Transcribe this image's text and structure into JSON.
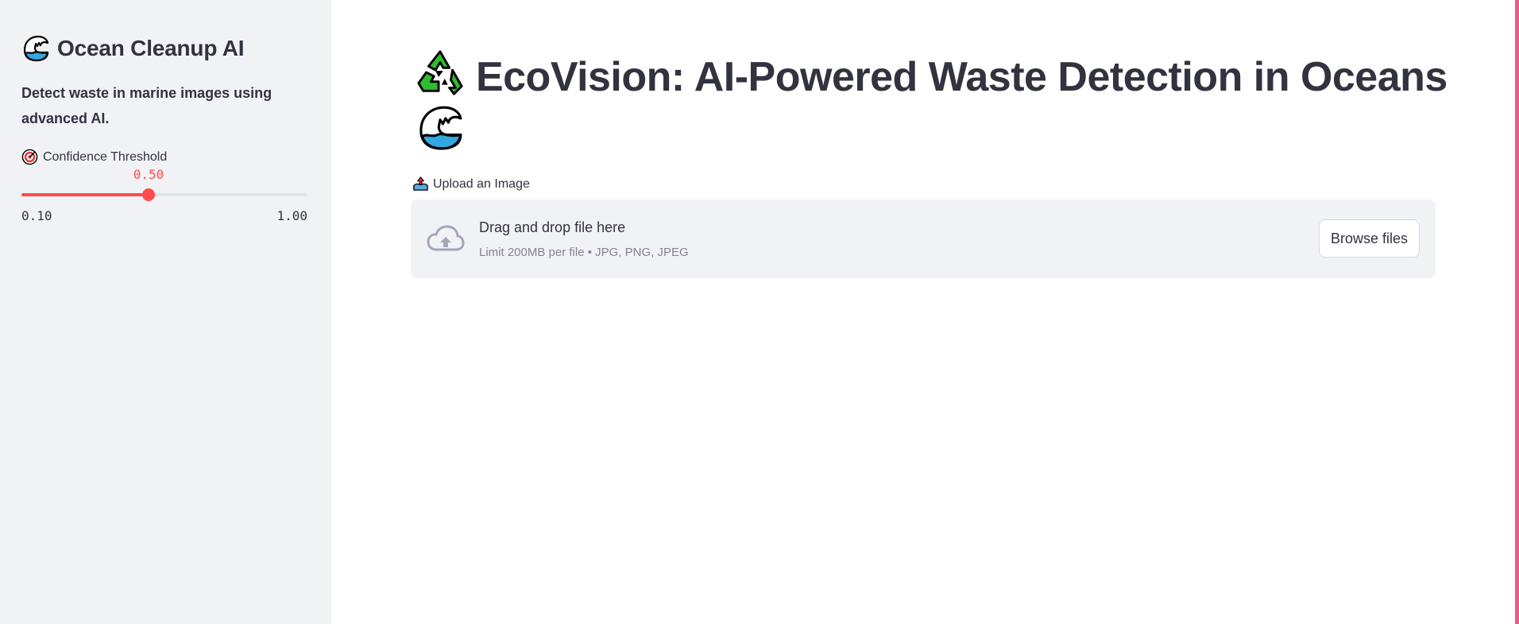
{
  "sidebar": {
    "title": "Ocean Cleanup AI",
    "title_icon": "wave-emoji",
    "description": "Detect waste in marine images using advanced AI.",
    "slider": {
      "label": "Confidence Threshold",
      "label_icon": "target-emoji",
      "value_text": "0.50",
      "min_text": "0.10",
      "max_text": "1.00",
      "value": 0.5,
      "min": 0.1,
      "max": 1.0
    }
  },
  "main": {
    "title": "EcoVision: AI-Powered Waste Detection in Oceans",
    "title_icons": [
      "recycle-emoji",
      "wave-emoji"
    ],
    "uploader": {
      "label": "Upload an Image",
      "label_icon": "outbox-tray-emoji",
      "drop_text": "Drag and drop file here",
      "limit_text": "Limit 200MB per file • JPG, PNG, JPEG",
      "browse_label": "Browse files"
    }
  },
  "colors": {
    "accent": "#ff4b4b",
    "sidebar_bg": "#f0f2f6",
    "text": "#31333f",
    "muted": "#808495",
    "right_edge": "#ec5c8c"
  }
}
